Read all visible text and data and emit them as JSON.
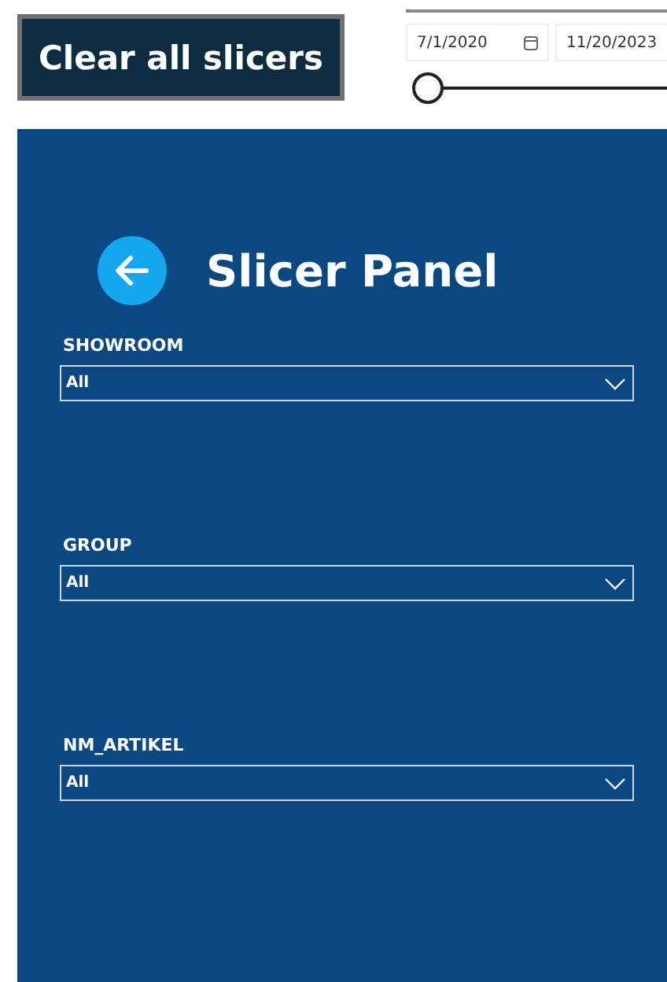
{
  "clear_button": {
    "label": "Clear all slicers"
  },
  "date_slicer": {
    "start": "7/1/2020",
    "end": "11/20/2023",
    "level": 0
  },
  "panel": {
    "title": "Slicer Panel",
    "slicers": [
      {
        "label": "SHOWROOM",
        "value": "All"
      },
      {
        "label": "GROUP",
        "value": "All"
      },
      {
        "label": "NM_ARTIKEL",
        "value": "All"
      }
    ]
  }
}
